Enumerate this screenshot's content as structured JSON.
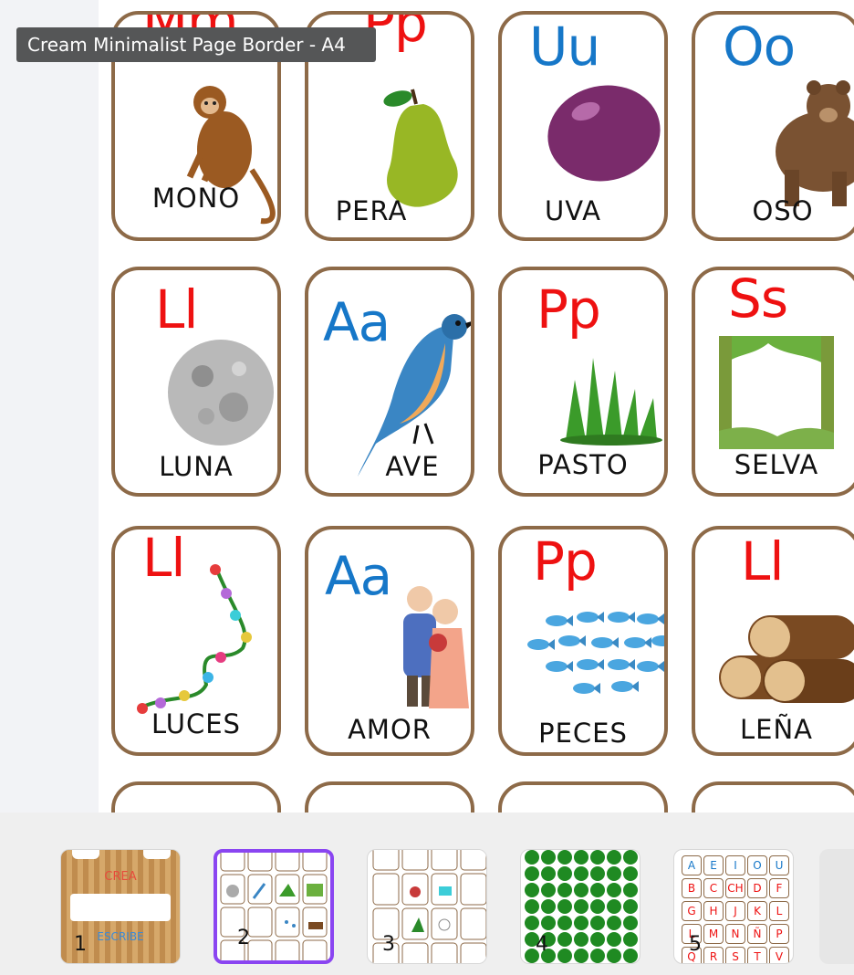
{
  "tooltip": "Cream Minimalist Page Border - A4",
  "colors": {
    "red": "#ee1111",
    "blue": "#1677c8",
    "border": "#8d6a48",
    "accent": "#8a45f1"
  },
  "cards": [
    {
      "letters": "Mm",
      "letter_color": "red",
      "word": "MONO",
      "icon": "monkey-icon"
    },
    {
      "letters": "Pp",
      "letter_color": "red",
      "word": "PERA",
      "icon": "pear-icon"
    },
    {
      "letters": "Uu",
      "letter_color": "blue",
      "word": "UVA",
      "icon": "grape-icon"
    },
    {
      "letters": "Oo",
      "letter_color": "blue",
      "word": "OSO",
      "icon": "bear-icon"
    },
    {
      "letters": "Ll",
      "letter_color": "red",
      "word": "LUNA",
      "icon": "moon-icon"
    },
    {
      "letters": "Aa",
      "letter_color": "blue",
      "word": "AVE",
      "icon": "bird-icon"
    },
    {
      "letters": "Pp",
      "letter_color": "red",
      "word": "PASTO",
      "icon": "grass-icon"
    },
    {
      "letters": "Ss",
      "letter_color": "red",
      "word": "SELVA",
      "icon": "jungle-icon"
    },
    {
      "letters": "Ll",
      "letter_color": "red",
      "word": "LUCES",
      "icon": "lights-icon"
    },
    {
      "letters": "Aa",
      "letter_color": "blue",
      "word": "AMOR",
      "icon": "couple-icon"
    },
    {
      "letters": "Pp",
      "letter_color": "red",
      "word": "PECES",
      "icon": "fish-icon"
    },
    {
      "letters": "Ll",
      "letter_color": "red",
      "word": "LEÑA",
      "icon": "logs-icon"
    }
  ],
  "thumbnails": [
    {
      "number": "1",
      "label_top": "CREA",
      "label_bottom": "ESCRIBE"
    },
    {
      "number": "2"
    },
    {
      "number": "3"
    },
    {
      "number": "4"
    },
    {
      "number": "5",
      "letters": [
        "A",
        "E",
        "I",
        "O",
        "U",
        "B",
        "C",
        "CH",
        "D",
        "F",
        "G",
        "H",
        "J",
        "K",
        "L",
        "L",
        "M",
        "N",
        "Ñ",
        "P",
        "Q",
        "R",
        "S",
        "T",
        "V"
      ]
    }
  ]
}
